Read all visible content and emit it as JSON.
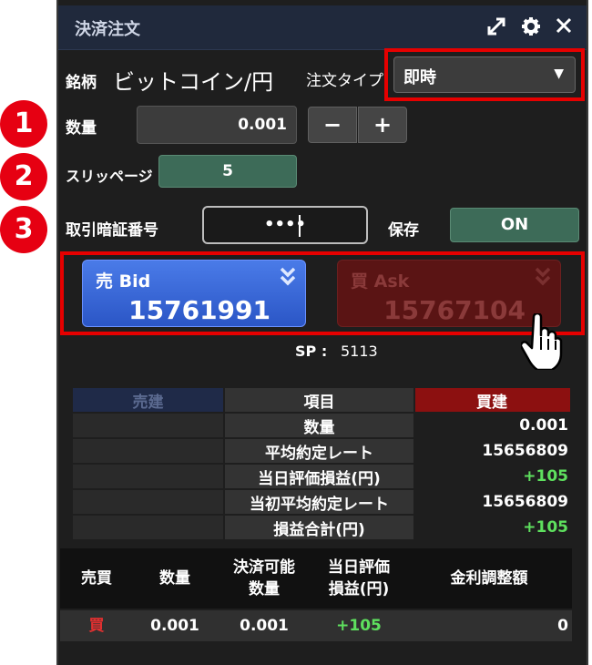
{
  "window": {
    "title": "決済注文"
  },
  "form": {
    "symbol_label": "銘柄",
    "symbol_value": "ビットコイン/円",
    "order_type_label": "注文タイプ",
    "order_type_value": "即時",
    "qty_label": "数量",
    "qty_value": "0.001",
    "minus": "−",
    "plus": "+",
    "slippage_label": "スリッページ",
    "slippage_value": "5",
    "password_label": "取引暗証番号",
    "password_value": "••••",
    "save_label": "保存",
    "save_toggle": "ON"
  },
  "badges": [
    "1",
    "2",
    "3"
  ],
  "quote": {
    "bid_label": "売 Bid",
    "bid_price": "15761991",
    "ask_label": "買 Ask",
    "ask_price": "15767104",
    "sp_label": "SP :",
    "sp_value": "5113"
  },
  "summary": {
    "headers": [
      "売建",
      "項目",
      "買建"
    ],
    "rows": [
      {
        "item": "数量",
        "buy": "0.001"
      },
      {
        "item": "平均約定レート",
        "buy": "15656809"
      },
      {
        "item": "当日評価損益(円)",
        "buy": "+105"
      },
      {
        "item": "当初平均約定レート",
        "buy": "15656809"
      },
      {
        "item": "損益合計(円)",
        "buy": "+105"
      }
    ]
  },
  "positions": {
    "headers": [
      "売買",
      "数量",
      "決済可能\n数量",
      "当日評価\n損益(円)",
      "金利調整額"
    ],
    "row": {
      "side": "買",
      "qty": "0.001",
      "closable": "0.001",
      "pnl": "+105",
      "interest": "0"
    }
  },
  "colors": {
    "accent_red": "#e60000",
    "profit_green": "#5ee05e",
    "buy_red": "#e03030"
  },
  "icons": [
    "expand-icon",
    "gear-icon",
    "close-icon",
    "chevron-down-icon",
    "double-chevron-down-icon",
    "hand-pointer-icon"
  ]
}
